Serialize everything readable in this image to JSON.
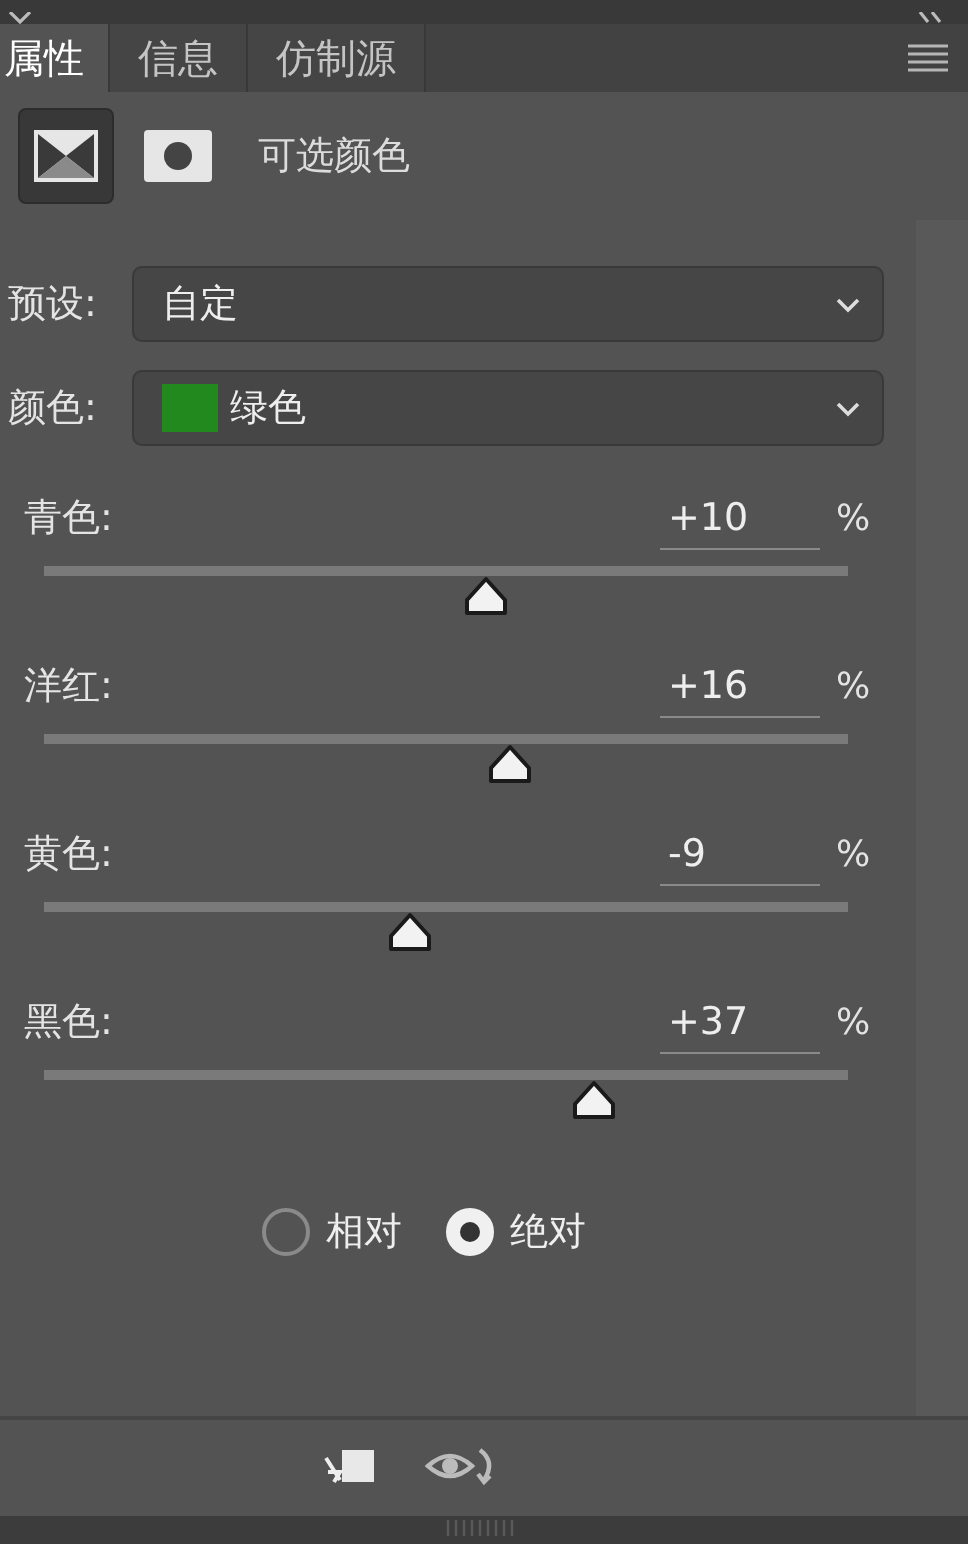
{
  "tabs": [
    {
      "label": "属性",
      "selected": true
    },
    {
      "label": "信息",
      "selected": false
    },
    {
      "label": "仿制源",
      "selected": false
    }
  ],
  "header": {
    "title": "可选颜色",
    "icons": [
      {
        "kind": "adjustment",
        "selected": true
      },
      {
        "kind": "mask",
        "selected": false
      }
    ]
  },
  "preset": {
    "label": "预设:",
    "value": "自定"
  },
  "color": {
    "label": "颜色:",
    "value": "绿色",
    "color": "#22891f"
  },
  "sliders": [
    {
      "label": "青色:",
      "value": "+10",
      "unit": "%",
      "level": 0.55
    },
    {
      "label": "洋红:",
      "value": "+16",
      "unit": "%",
      "level": 0.58
    },
    {
      "label": "黄色:",
      "value": "-9",
      "unit": "%",
      "level": 0.455
    },
    {
      "label": "黑色:",
      "value": "+37",
      "unit": "%",
      "level": 0.685
    }
  ],
  "method": [
    {
      "label": "相对",
      "selected": false
    },
    {
      "label": "绝对",
      "selected": true
    }
  ]
}
